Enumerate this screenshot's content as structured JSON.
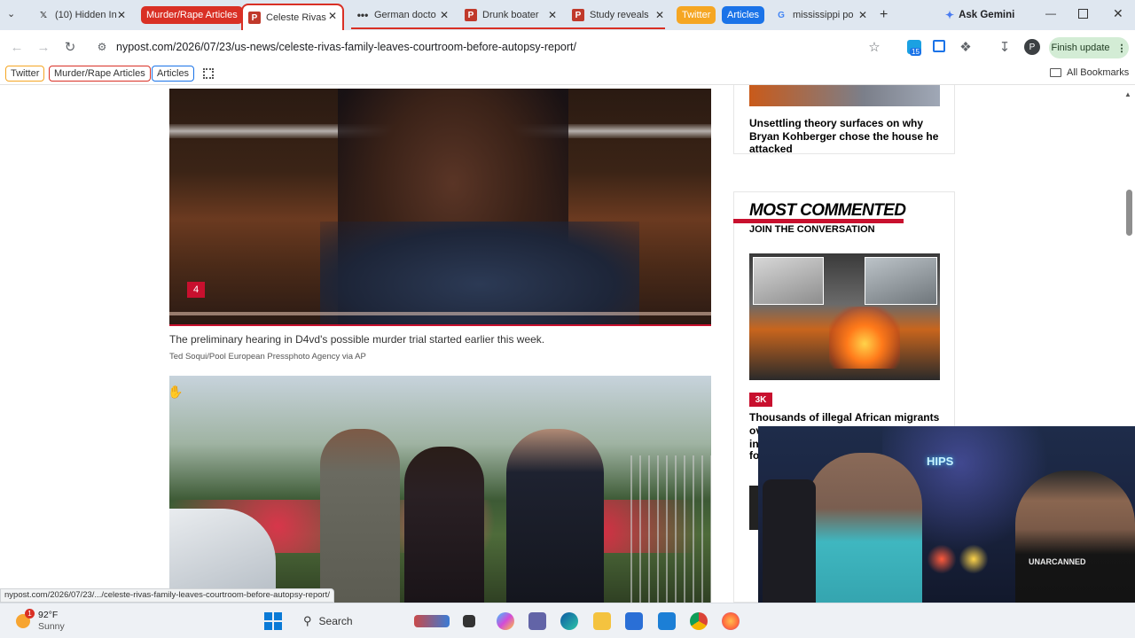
{
  "browser": {
    "tabs": [
      {
        "label": "(10) Hidden In",
        "icon": "x-logo-icon"
      },
      {
        "label": "Murder/Rape Articles",
        "icon": "tab-group-pill",
        "color": "#d93025"
      },
      {
        "label": "Celeste Rivas",
        "icon": "nypost-icon"
      },
      {
        "label": "German doctor",
        "icon": "dots-icon"
      },
      {
        "label": "Drunk boater",
        "icon": "nypost-icon"
      },
      {
        "label": "Study reveals",
        "icon": "nypost-icon"
      },
      {
        "label": "Twitter",
        "icon": "tab-group-pill",
        "color": "#f5a623"
      },
      {
        "label": "Articles",
        "icon": "tab-group-pill",
        "color": "#1a73e8"
      },
      {
        "label": "mississippi po",
        "icon": "google-icon"
      }
    ],
    "ask_gemini": "Ask Gemini",
    "url": "nypost.com/2026/07/23/us-news/celeste-rivas-family-leaves-courtroom-before-autopsy-report/",
    "extension_badge": "15",
    "profile_initial": "P",
    "finish_update": "Finish update",
    "bookmarks": [
      {
        "label": "Twitter",
        "color": "#f5a623"
      },
      {
        "label": "Murder/Rape Articles",
        "color": "#d93025"
      },
      {
        "label": "Articles",
        "color": "#1a73e8"
      }
    ],
    "all_bookmarks": "All Bookmarks",
    "status_url": "nypost.com/2026/07/23/.../celeste-rivas-family-leaves-courtroom-before-autopsy-report/"
  },
  "article": {
    "photo_counter": "4",
    "caption": "The preliminary hearing in D4vd's possible murder trial started earlier this week.",
    "credit": "Ted Soqui/Pool European Pressphoto Agency via AP"
  },
  "sidebar": {
    "top_story": "Unsettling theory surfaces on why Bryan Kohberger chose the house he attacked",
    "most_commented": "MOST COMMENTED",
    "join": "JOIN THE CONVERSATION",
    "comment_count": "3K",
    "story_title": "Thousands of illegal African migrants",
    "story_partial": [
      "ov",
      "in",
      "fo"
    ]
  },
  "overlay": {
    "sign_text": "HIPS",
    "shirt_text": "UNARCANNED"
  },
  "taskbar": {
    "weather_temp": "92°F",
    "weather_desc": "Sunny",
    "weather_badge": "1",
    "search": "Search"
  }
}
